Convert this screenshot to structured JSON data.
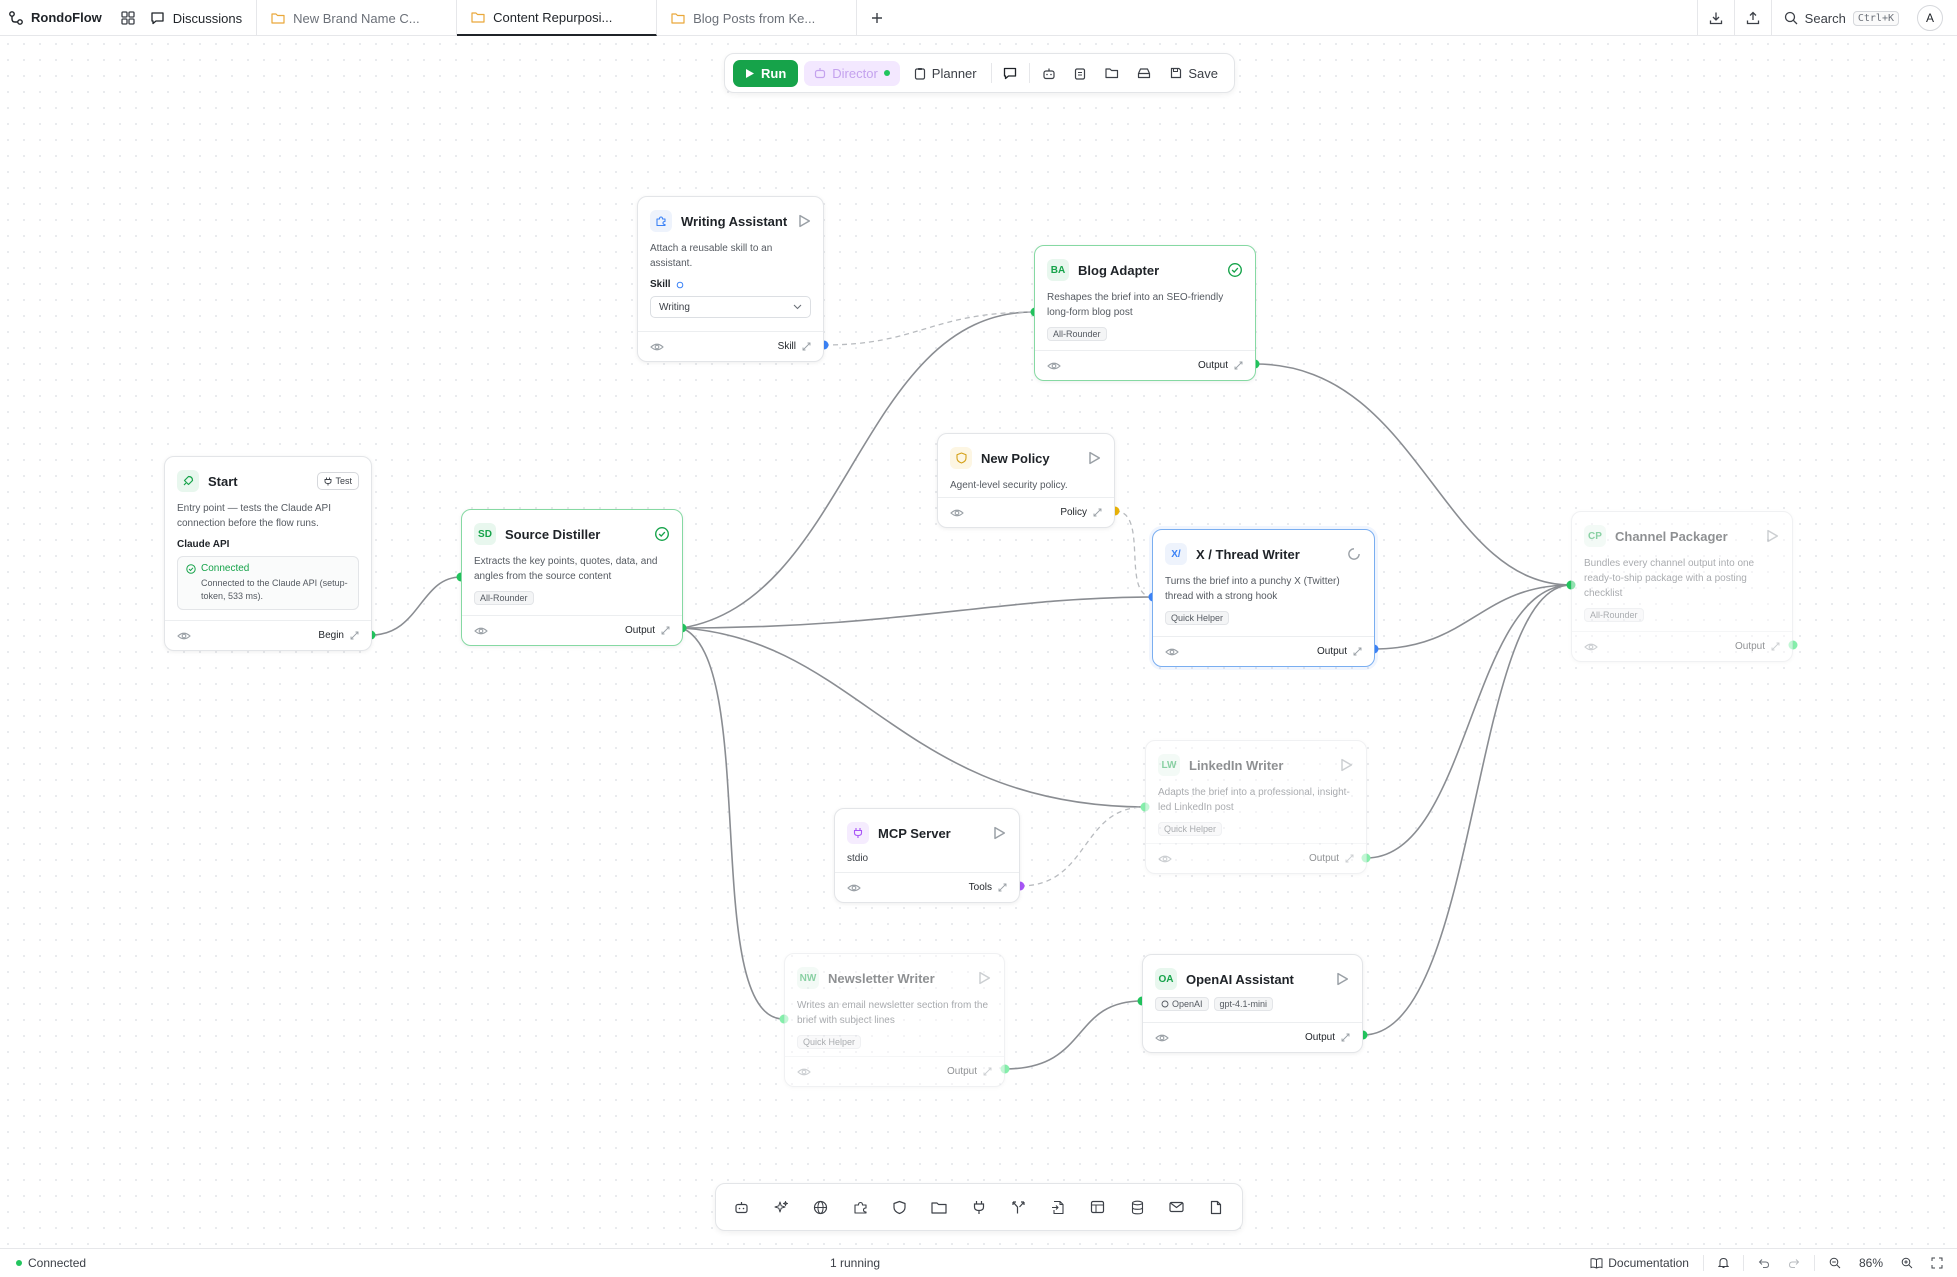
{
  "app": {
    "name": "RondoFlow"
  },
  "tabs": [
    {
      "label": "Discussions"
    },
    {
      "label": "New Brand Name C..."
    },
    {
      "label": "Content Repurposi..."
    },
    {
      "label": "Blog Posts from Ke..."
    }
  ],
  "topbar": {
    "search_label": "Search",
    "search_shortcut": "Ctrl+K",
    "avatar_initial": "A"
  },
  "toolbar": {
    "run": "Run",
    "director": "Director",
    "planner": "Planner",
    "save": "Save"
  },
  "nodes": {
    "start": {
      "title": "Start",
      "test": "Test",
      "desc": "Entry point — tests the Claude API connection before the flow runs.",
      "section": "Claude API",
      "status": "Connected",
      "status_detail": "Connected to the Claude API (setup-token, 533 ms).",
      "port": "Begin"
    },
    "writing_assistant": {
      "title": "Writing Assistant",
      "desc": "Attach a reusable skill to an assistant.",
      "field_label": "Skill",
      "field_value": "Writing",
      "port": "Skill"
    },
    "source_distiller": {
      "badge": "SD",
      "title": "Source Distiller",
      "desc": "Extracts the key points, quotes, data, and angles from the source content",
      "chip": "All-Rounder",
      "port": "Output"
    },
    "blog_adapter": {
      "badge": "BA",
      "title": "Blog Adapter",
      "desc": "Reshapes the brief into an SEO-friendly long-form blog post",
      "chip": "All-Rounder",
      "port": "Output"
    },
    "new_policy": {
      "title": "New Policy",
      "desc": "Agent-level security policy.",
      "port": "Policy"
    },
    "x_thread_writer": {
      "badge": "X/",
      "title": "X / Thread Writer",
      "desc": "Turns the brief into a punchy X (Twitter) thread with a strong hook",
      "chip": "Quick Helper",
      "port": "Output"
    },
    "channel_packager": {
      "badge": "CP",
      "title": "Channel Packager",
      "desc": "Bundles every channel output into one ready-to-ship package with a posting checklist",
      "chip": "All-Rounder",
      "port": "Output"
    },
    "linkedin_writer": {
      "badge": "LW",
      "title": "LinkedIn Writer",
      "desc": "Adapts the brief into a professional, insight-led LinkedIn post",
      "chip": "Quick Helper",
      "port": "Output"
    },
    "mcp_server": {
      "title": "MCP Server",
      "desc": "stdio",
      "port": "Tools"
    },
    "newsletter_writer": {
      "badge": "NW",
      "title": "Newsletter Writer",
      "desc": "Writes an email newsletter section from the brief with subject lines",
      "chip": "Quick Helper",
      "port": "Output"
    },
    "openai_assistant": {
      "badge": "OA",
      "title": "OpenAI Assistant",
      "chip_provider": "OpenAI",
      "chip_model": "gpt-4.1-mini",
      "port": "Output"
    }
  },
  "statusbar": {
    "connection": "Connected",
    "running": "1 running",
    "documentation": "Documentation",
    "zoom": "86%"
  },
  "colors": {
    "accent_green": "#16a34a",
    "port_blue": "#3b82f6",
    "port_purple": "#a855f7",
    "port_amber": "#eab308",
    "director_bg": "#f3e8ff"
  }
}
